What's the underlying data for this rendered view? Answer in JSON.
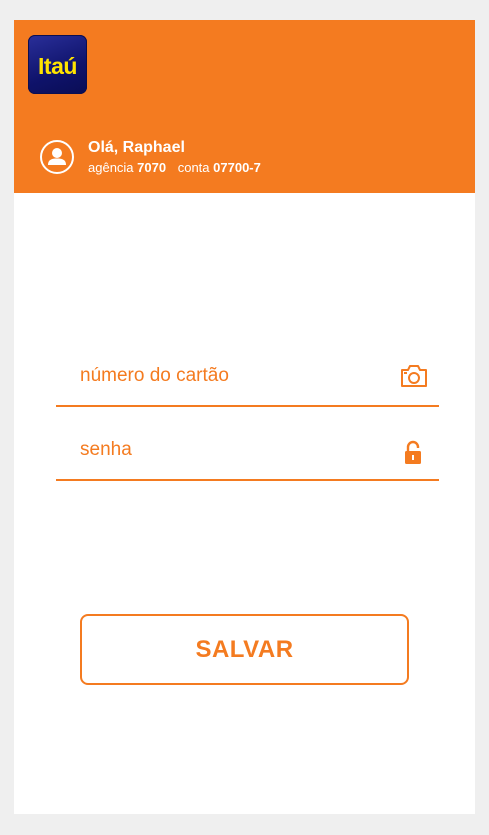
{
  "header": {
    "logo_text": "Itaú",
    "greeting": "Olá, Raphael",
    "agency_label": "agência",
    "agency_value": "7070",
    "account_label": "conta",
    "account_value": "07700-7"
  },
  "form": {
    "card_placeholder": "número do cartão",
    "password_placeholder": "senha",
    "card_icon": "camera-icon",
    "password_icon": "lock-icon"
  },
  "actions": {
    "save_label": "SALVAR"
  },
  "colors": {
    "brand_orange": "#f47b20",
    "logo_blue": "#0f136b",
    "logo_yellow": "#ffe400",
    "background": "#efefef"
  }
}
